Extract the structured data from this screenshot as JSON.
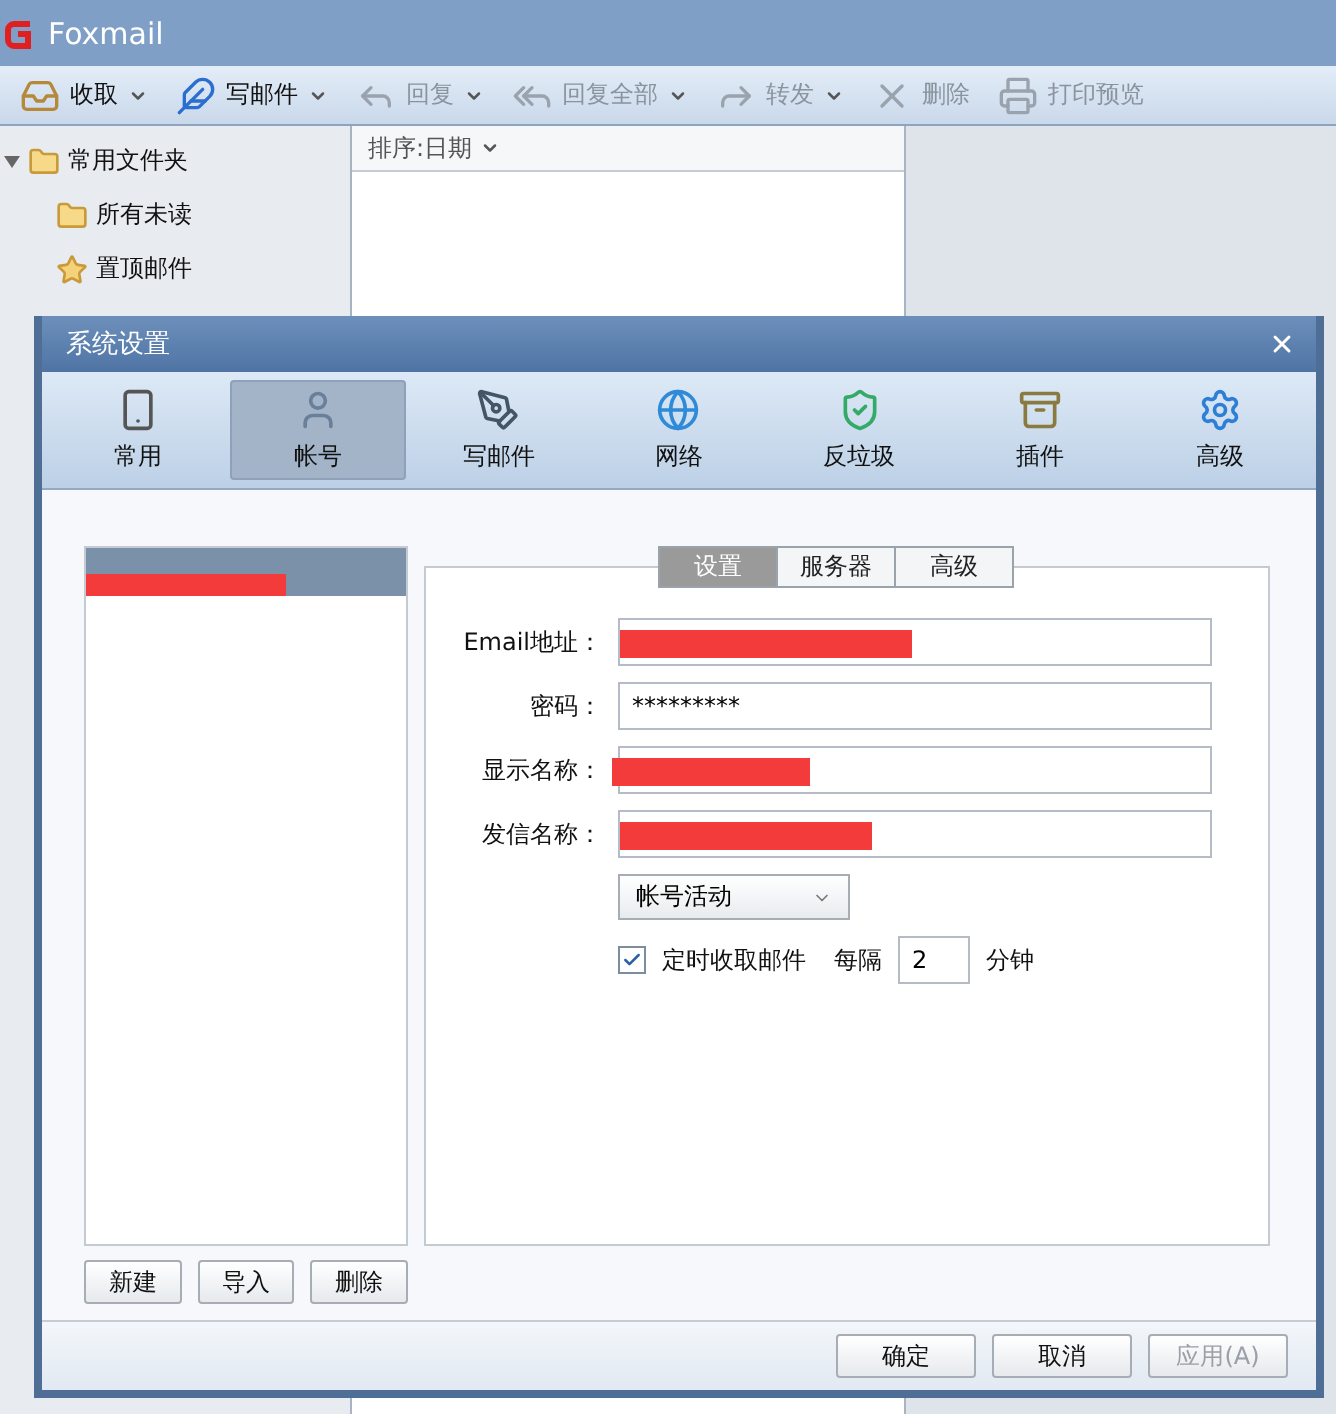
{
  "app": {
    "title": "Foxmail"
  },
  "toolbar": [
    {
      "label": "收取",
      "disabled": false,
      "dropdown": true
    },
    {
      "label": "写邮件",
      "disabled": false,
      "dropdown": true
    },
    {
      "label": "回复",
      "disabled": true,
      "dropdown": true
    },
    {
      "label": "回复全部",
      "disabled": true,
      "dropdown": true
    },
    {
      "label": "转发",
      "disabled": true,
      "dropdown": true
    },
    {
      "label": "删除",
      "disabled": true,
      "dropdown": false
    },
    {
      "label": "打印预览",
      "disabled": true,
      "dropdown": false
    }
  ],
  "folders": [
    {
      "label": "常用文件夹",
      "expanded": true,
      "children": [
        {
          "label": "所有未读"
        },
        {
          "label": "置顶邮件"
        }
      ]
    }
  ],
  "mail_list": {
    "sort": "排序:日期"
  },
  "dialog": {
    "title": "系统设置",
    "tabs": [
      {
        "label": "常用",
        "selected": false
      },
      {
        "label": "帐号",
        "selected": true
      },
      {
        "label": "写邮件",
        "selected": false
      },
      {
        "label": "网络",
        "selected": false
      },
      {
        "label": "反垃圾",
        "selected": false
      },
      {
        "label": "插件",
        "selected": false
      },
      {
        "label": "高级",
        "selected": false
      }
    ],
    "accounts": [
      {
        "selected": true,
        "redacted": true
      }
    ],
    "account_buttons": [
      "新建",
      "导入",
      "删除"
    ],
    "subtabs": [
      {
        "label": "设置",
        "selected": true
      },
      {
        "label": "服务器",
        "selected": false
      },
      {
        "label": "高级",
        "selected": false
      }
    ],
    "fields": [
      {
        "label": "Email地址：",
        "redacted": true
      },
      {
        "label": "密码：",
        "value": "*********",
        "redacted": false
      },
      {
        "label": "显示名称：",
        "redacted": true
      },
      {
        "label": "发信名称：",
        "redacted": true
      }
    ],
    "status_select": "帐号活动",
    "auto_check": {
      "label": "定时收取邮件",
      "checked": true
    },
    "interval": {
      "label": "每隔",
      "value": "2",
      "unit": "分钟"
    },
    "buttons": [
      {
        "label": "确定",
        "disabled": false
      },
      {
        "label": "取消",
        "disabled": false
      },
      {
        "label": "应用(A)",
        "disabled": true
      }
    ]
  }
}
